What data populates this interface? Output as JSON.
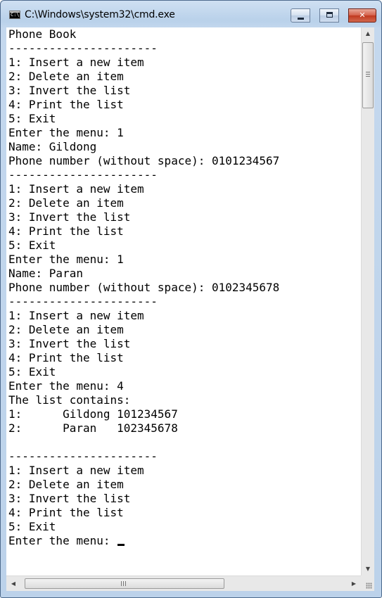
{
  "window": {
    "title": "C:\\Windows\\system32\\cmd.exe",
    "icon_text": "C:\\",
    "controls": {
      "minimize_icon": "minimize-icon",
      "maximize_icon": "maximize-icon",
      "close_label": "✕"
    }
  },
  "console": {
    "output": "Phone Book\n----------------------\n1: Insert a new item\n2: Delete an item\n3: Invert the list\n4: Print the list\n5: Exit\nEnter the menu: 1\nName: Gildong\nPhone number (without space): 0101234567\n----------------------\n1: Insert a new item\n2: Delete an item\n3: Invert the list\n4: Print the list\n5: Exit\nEnter the menu: 1\nName: Paran\nPhone number (without space): 0102345678\n----------------------\n1: Insert a new item\n2: Delete an item\n3: Invert the list\n4: Print the list\n5: Exit\nEnter the menu: 4\nThe list contains:\n1:      Gildong 101234567\n2:      Paran   102345678\n\n----------------------\n1: Insert a new item\n2: Delete an item\n3: Invert the list\n4: Print the list\n5: Exit\nEnter the menu: "
  },
  "scrollbars": {
    "vertical": {
      "up_arrow": "▲",
      "down_arrow": "▼"
    },
    "horizontal": {
      "left_arrow": "◀",
      "right_arrow": "▶"
    }
  },
  "colors": {
    "console_bg": "#ffffff",
    "console_fg": "#000000",
    "titlebar": "#b9d1ea",
    "close_button": "#c0391f"
  }
}
